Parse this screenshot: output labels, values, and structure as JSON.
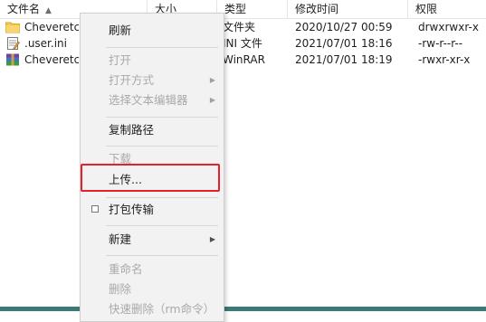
{
  "columns": {
    "name": "文件名",
    "size": "大小",
    "type": "类型",
    "modified": "修改时间",
    "perms": "权限"
  },
  "files": [
    {
      "name": "Cheveretc",
      "type": "文件夹",
      "modified": "2020/10/27 00:59",
      "perms": "drwxrwxr-x",
      "icon": "folder-icon"
    },
    {
      "name": ".user.ini",
      "type": "INI 文件",
      "modified": "2021/07/01 18:16",
      "perms": "-rw-r--r--",
      "icon": "ini-file-icon"
    },
    {
      "name": "Cheveretc",
      "type": "WinRAR",
      "modified": "2021/07/01 18:19",
      "perms": "-rwxr-xr-x",
      "icon": "winrar-archive-icon"
    }
  ],
  "menu": {
    "refresh": "刷新",
    "open": "打开",
    "open_with": "打开方式",
    "choose_editor": "选择文本编辑器",
    "copy_path": "复制路径",
    "download": "下载",
    "upload": "上传...",
    "pack_transfer": "打包传输",
    "new": "新建",
    "rename": "重命名",
    "delete": "删除",
    "quick_delete": "快速删除（rm命令）"
  },
  "colors": {
    "highlight_border": "#e3202b",
    "folder": "#f3c652",
    "accent_bar": "#3c7a78"
  }
}
